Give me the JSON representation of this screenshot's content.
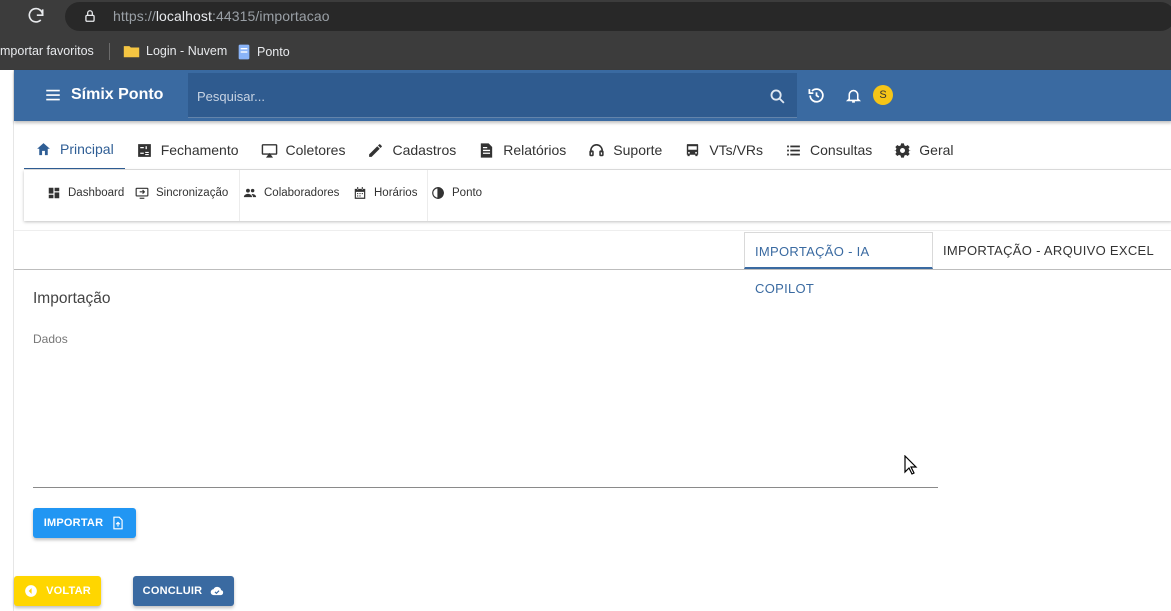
{
  "browser": {
    "url_prefix": "https://",
    "url_host": "localhost",
    "url_rest": ":44315/importacao",
    "bookmarks": [
      {
        "label": "mportar favoritos"
      },
      {
        "label": "Login - Nuvem",
        "icon": "folder-icon"
      },
      {
        "label": "Ponto",
        "icon": "document-icon"
      }
    ]
  },
  "topbar": {
    "brand": "Símix Ponto",
    "search_placeholder": "Pesquisar...",
    "avatar_initial": "S",
    "color": "#3a6aa1"
  },
  "main_nav": [
    {
      "label": "Principal",
      "icon": "home-icon",
      "active": true
    },
    {
      "label": "Fechamento",
      "icon": "calculator-icon"
    },
    {
      "label": "Coletores",
      "icon": "monitor-icon"
    },
    {
      "label": "Cadastros",
      "icon": "pencil-icon"
    },
    {
      "label": "Relatórios",
      "icon": "report-icon"
    },
    {
      "label": "Suporte",
      "icon": "headset-icon"
    },
    {
      "label": "VTs/VRs",
      "icon": "bus-icon"
    },
    {
      "label": "Consultas",
      "icon": "list-icon"
    },
    {
      "label": "Geral",
      "icon": "gear-icon"
    }
  ],
  "sub_nav": [
    {
      "label": "Dashboard",
      "icon": "dashboard-icon"
    },
    {
      "label": "Sincronização",
      "icon": "sync-icon"
    },
    {
      "label": "Colaboradores",
      "icon": "people-icon"
    },
    {
      "label": "Horários",
      "icon": "calendar-icon"
    },
    {
      "label": "Ponto",
      "icon": "clock-icon"
    }
  ],
  "import_tabs": [
    {
      "label": "IMPORTAÇÃO - IA COPILOT",
      "active": true
    },
    {
      "label": "IMPORTAÇÃO - ARQUIVO EXCEL",
      "active": false
    }
  ],
  "form": {
    "title": "Importação",
    "field_label": "Dados",
    "field_value": ""
  },
  "buttons": {
    "import": "IMPORTAR",
    "back": "VOLTAR",
    "finish": "CONCLUIR"
  }
}
